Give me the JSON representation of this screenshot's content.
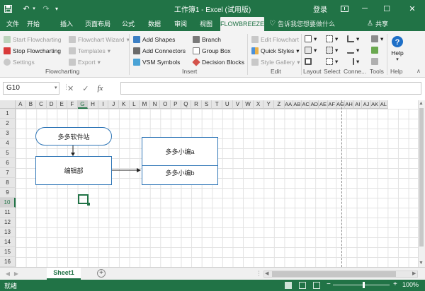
{
  "window": {
    "title": "工作簿1 - Excel (试用版)",
    "login_label": "登录"
  },
  "tabs": [
    "文件",
    "开始",
    "插入",
    "页面布局",
    "公式",
    "数据",
    "审阅",
    "视图",
    "FLOWBREEZE"
  ],
  "active_tab": "FLOWBREEZE",
  "tell_me": "告诉我您想要做什么",
  "share_label": "共享",
  "ribbon": {
    "flowcharting": {
      "start": "Start Flowcharting",
      "stop": "Stop Flowcharting",
      "settings": "Settings",
      "wizard": "Flowchart Wizard",
      "templates": "Templates",
      "export": "Export",
      "group_label": "Flowcharting"
    },
    "insert": {
      "add_shapes": "Add Shapes",
      "add_connectors": "Add Connectors",
      "vsm_symbols": "VSM Symbols",
      "branch": "Branch",
      "group_box": "Group Box",
      "decision_blocks": "Decision Blocks",
      "group_label": "Insert"
    },
    "edit": {
      "edit_flowchart": "Edit Flowchart",
      "quick_styles": "Quick Styles",
      "style_gallery": "Style Gallery",
      "group_label": "Edit"
    },
    "right_groups": {
      "layout": "Layout",
      "select": "Select",
      "connectors": "Conne...",
      "tools": "Tools",
      "help_button": "Help",
      "help_group": "Help"
    }
  },
  "formula_bar": {
    "name_box": "G10",
    "cancel_icon": "✕",
    "enter_icon": "✓",
    "fx_label": "fx",
    "value": ""
  },
  "columns": [
    "A",
    "B",
    "C",
    "D",
    "E",
    "F",
    "G",
    "H",
    "I",
    "J",
    "K",
    "L",
    "M",
    "N",
    "O",
    "P",
    "Q",
    "R",
    "S",
    "T",
    "U",
    "V",
    "W",
    "X",
    "Y",
    "Z",
    "AA",
    "AB",
    "AC",
    "AD",
    "AE",
    "AF",
    "AG",
    "AH",
    "AI",
    "AJ",
    "AK",
    "AL"
  ],
  "rows": [
    "1",
    "2",
    "3",
    "4",
    "5",
    "6",
    "7",
    "8",
    "9",
    "10",
    "11",
    "12",
    "13",
    "14",
    "15",
    "16"
  ],
  "selected": {
    "column": "G",
    "row": "10"
  },
  "shapes": {
    "start_terminator": "多多软件站",
    "process": "编辑部",
    "box_top": "多多小编a",
    "box_bottom": "多多小编b"
  },
  "sheets": [
    "Sheet1"
  ],
  "status": {
    "ready": "就绪",
    "zoom": "100%"
  },
  "colors": {
    "excel_green": "#217346",
    "shape_border": "#2e75b6"
  }
}
